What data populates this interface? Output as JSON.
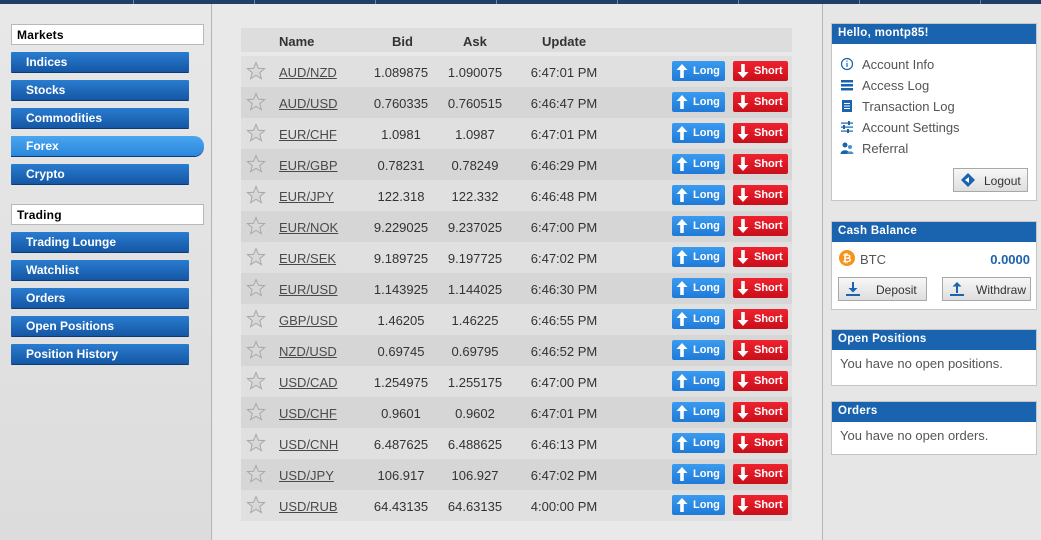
{
  "colors": {
    "brand_blue": "#1a63ae",
    "long_blue": "#2a8ae4",
    "short_red": "#e01a26",
    "balance_blue": "#1a63ae",
    "btc_orange": "#f7931a"
  },
  "sidebar": {
    "markets_heading": "Markets",
    "markets": [
      {
        "label": "Indices"
      },
      {
        "label": "Stocks"
      },
      {
        "label": "Commodities"
      },
      {
        "label": "Forex",
        "active": true
      },
      {
        "label": "Crypto"
      }
    ],
    "trading_heading": "Trading",
    "trading": [
      {
        "label": "Trading Lounge"
      },
      {
        "label": "Watchlist"
      },
      {
        "label": "Orders"
      },
      {
        "label": "Open Positions"
      },
      {
        "label": "Position History"
      }
    ]
  },
  "table": {
    "headers": {
      "name": "Name",
      "bid": "Bid",
      "ask": "Ask",
      "update": "Update"
    },
    "long_label": "Long",
    "short_label": "Short",
    "rows": [
      {
        "name": "AUD/NZD",
        "bid": "1.089875",
        "ask": "1.090075",
        "update": "6:47:01 PM"
      },
      {
        "name": "AUD/USD",
        "bid": "0.760335",
        "ask": "0.760515",
        "update": "6:46:47 PM"
      },
      {
        "name": "EUR/CHF",
        "bid": "1.0981",
        "ask": "1.0987",
        "update": "6:47:01 PM"
      },
      {
        "name": "EUR/GBP",
        "bid": "0.78231",
        "ask": "0.78249",
        "update": "6:46:29 PM"
      },
      {
        "name": "EUR/JPY",
        "bid": "122.318",
        "ask": "122.332",
        "update": "6:46:48 PM"
      },
      {
        "name": "EUR/NOK",
        "bid": "9.229025",
        "ask": "9.237025",
        "update": "6:47:00 PM"
      },
      {
        "name": "EUR/SEK",
        "bid": "9.189725",
        "ask": "9.197725",
        "update": "6:47:02 PM"
      },
      {
        "name": "EUR/USD",
        "bid": "1.143925",
        "ask": "1.144025",
        "update": "6:46:30 PM"
      },
      {
        "name": "GBP/USD",
        "bid": "1.46205",
        "ask": "1.46225",
        "update": "6:46:55 PM"
      },
      {
        "name": "NZD/USD",
        "bid": "0.69745",
        "ask": "0.69795",
        "update": "6:46:52 PM"
      },
      {
        "name": "USD/CAD",
        "bid": "1.254975",
        "ask": "1.255175",
        "update": "6:47:00 PM"
      },
      {
        "name": "USD/CHF",
        "bid": "0.9601",
        "ask": "0.9602",
        "update": "6:47:01 PM"
      },
      {
        "name": "USD/CNH",
        "bid": "6.487625",
        "ask": "6.488625",
        "update": "6:46:13 PM"
      },
      {
        "name": "USD/JPY",
        "bid": "106.917",
        "ask": "106.927",
        "update": "6:47:02 PM"
      },
      {
        "name": "USD/RUB",
        "bid": "64.43135",
        "ask": "64.63135",
        "update": "4:00:00 PM"
      }
    ]
  },
  "account": {
    "greeting": "Hello, montp85!",
    "menu": [
      {
        "label": "Account Info",
        "icon": "info-icon"
      },
      {
        "label": "Access Log",
        "icon": "list-icon"
      },
      {
        "label": "Transaction Log",
        "icon": "document-icon"
      },
      {
        "label": "Account Settings",
        "icon": "sliders-icon"
      },
      {
        "label": "Referral",
        "icon": "users-icon"
      }
    ],
    "logout_label": "Logout"
  },
  "cash": {
    "heading": "Cash Balance",
    "currency": "BTC",
    "amount": "0.0000",
    "deposit_label": "Deposit",
    "withdraw_label": "Withdraw"
  },
  "open_positions": {
    "heading": "Open Positions",
    "message": "You have no open positions."
  },
  "orders": {
    "heading": "Orders",
    "message": "You have no open orders."
  }
}
